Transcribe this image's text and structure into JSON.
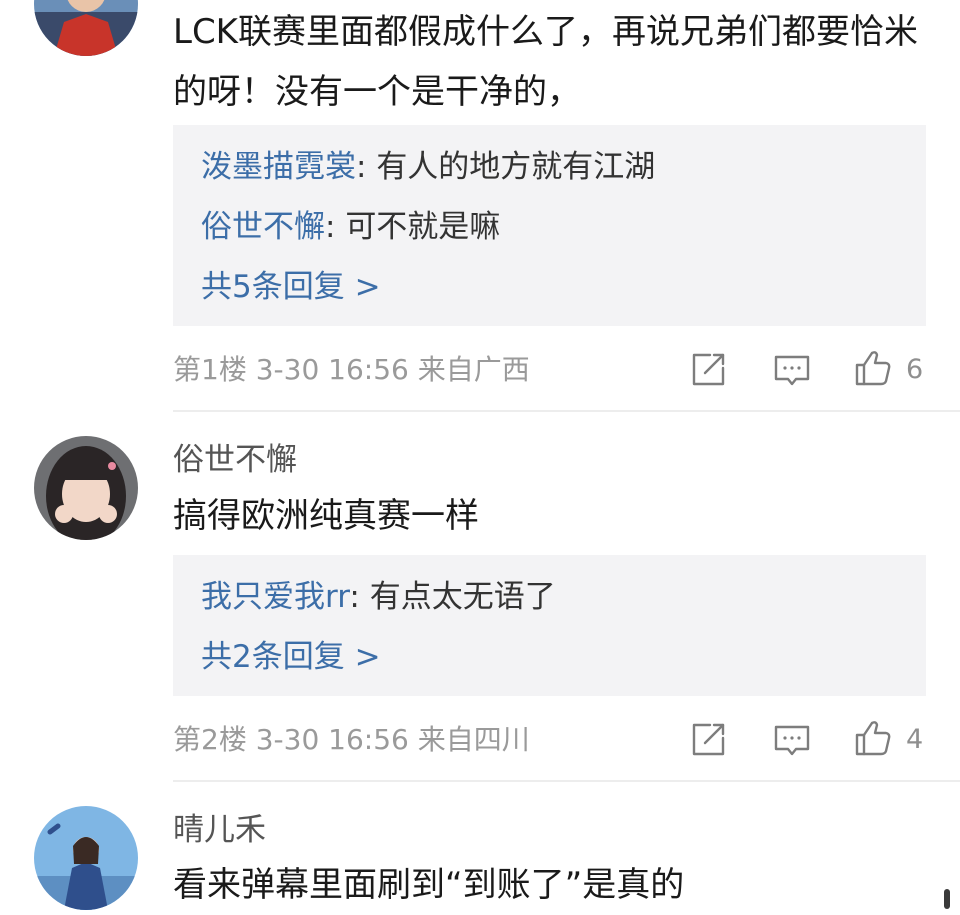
{
  "comments": [
    {
      "content": "LCK联赛里面都假成什么了，再说兄弟们都要恰米的呀！没有一个是干净的，",
      "replies": [
        {
          "user": "泼墨描霓裳",
          "text": "有人的地方就有江湖"
        },
        {
          "user": "俗世不懈",
          "text": "可不就是嘛"
        }
      ],
      "more": "共5条回复 >",
      "meta": "第1楼  3-30 16:56  来自广西",
      "likes": "6"
    },
    {
      "username": "俗世不懈",
      "content": "搞得欧洲纯真赛一样",
      "replies": [
        {
          "user": "我只爱我rr",
          "text": "有点太无语了"
        }
      ],
      "more": "共2条回复 >",
      "meta": "第2楼  3-30 16:56  来自四川",
      "likes": "4"
    },
    {
      "username": "晴儿禾",
      "content": "看来弹幕里面刷到“到账了”是真的"
    }
  ],
  "icons": {
    "share": "share-icon",
    "comment": "comment-icon",
    "like": "thumbs-up-icon"
  },
  "colors": {
    "link": "#3c6ea8",
    "reply_bg": "#f3f3f5",
    "meta": "#9a9a9a"
  }
}
